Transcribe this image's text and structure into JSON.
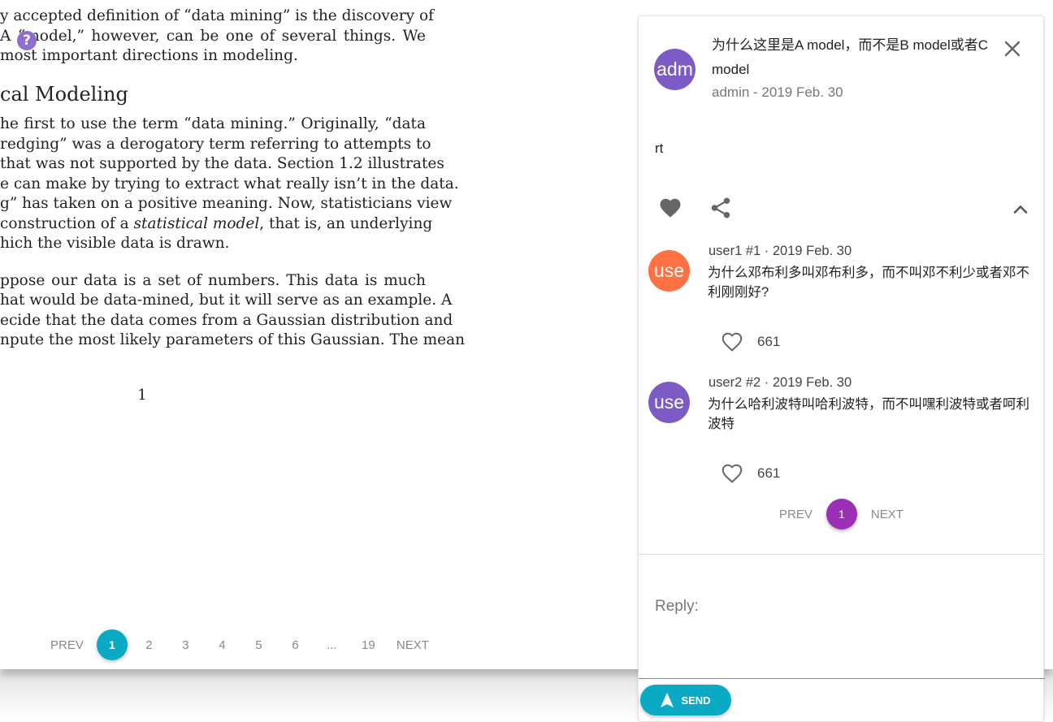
{
  "document": {
    "para1": [
      "y accepted definition of “data mining” is the discovery of",
      "A “model,” however, can be one of several things.  We",
      "most important directions in modeling."
    ],
    "section_heading": "cal Modeling",
    "para2": [
      "he first to use the term “data mining.”  Originally, “data",
      "redging” was a derogatory term referring to attempts to",
      "that was not supported by the data. Section 1.2 illustrates",
      "e can make by trying to extract what really isn’t in the data.",
      "g” has taken on a positive meaning. Now, statisticians view",
      "construction of a statistical model, that is, an underlying",
      "hich the visible data is drawn."
    ],
    "para3": [
      "ppose our data is a set of numbers.  This data is much",
      "hat would be data-mined, but it will serve as an example.  A",
      "ecide that the data comes from a Gaussian distribution and",
      "npute the most likely parameters of this Gaussian.  The mean"
    ],
    "page_number": "1",
    "marker_symbol": "?"
  },
  "pager": {
    "prev": "PREV",
    "current": "1",
    "pages": [
      "2",
      "3",
      "4",
      "5",
      "6",
      "...",
      "19"
    ],
    "next": "NEXT",
    "accent": "#0aa9c4"
  },
  "thread": {
    "avatar_text": "adm",
    "avatar_color": "#7c5cc4",
    "title": "为什么这里是A model，而不是B model或者C model",
    "meta": "admin - 2019 Feb. 30",
    "body": "rt",
    "icons": [
      "close-icon",
      "heart-icon",
      "share-icon",
      "chevron-up-icon"
    ]
  },
  "replies": [
    {
      "avatar_text": "use",
      "avatar_color": "#ff7043",
      "header": "user1  #1 · 2019 Feb. 30",
      "text": "为什么邓布利多叫邓布利多，而不叫邓不利少或者邓不利刚刚好?",
      "likes": "661"
    },
    {
      "avatar_text": "use",
      "avatar_color": "#7c5cc4",
      "header": "user2  #2 · 2019 Feb. 30",
      "text": "为什么哈利波特叫哈利波特，而不叫嘿利波特或者呵利波特",
      "likes": "661"
    }
  ],
  "panel_pager": {
    "prev": "PREV",
    "current": "1",
    "next": "NEXT",
    "accent": "#9b2fb6"
  },
  "reply_box": {
    "placeholder": "Reply:",
    "send_label": "SEND"
  }
}
